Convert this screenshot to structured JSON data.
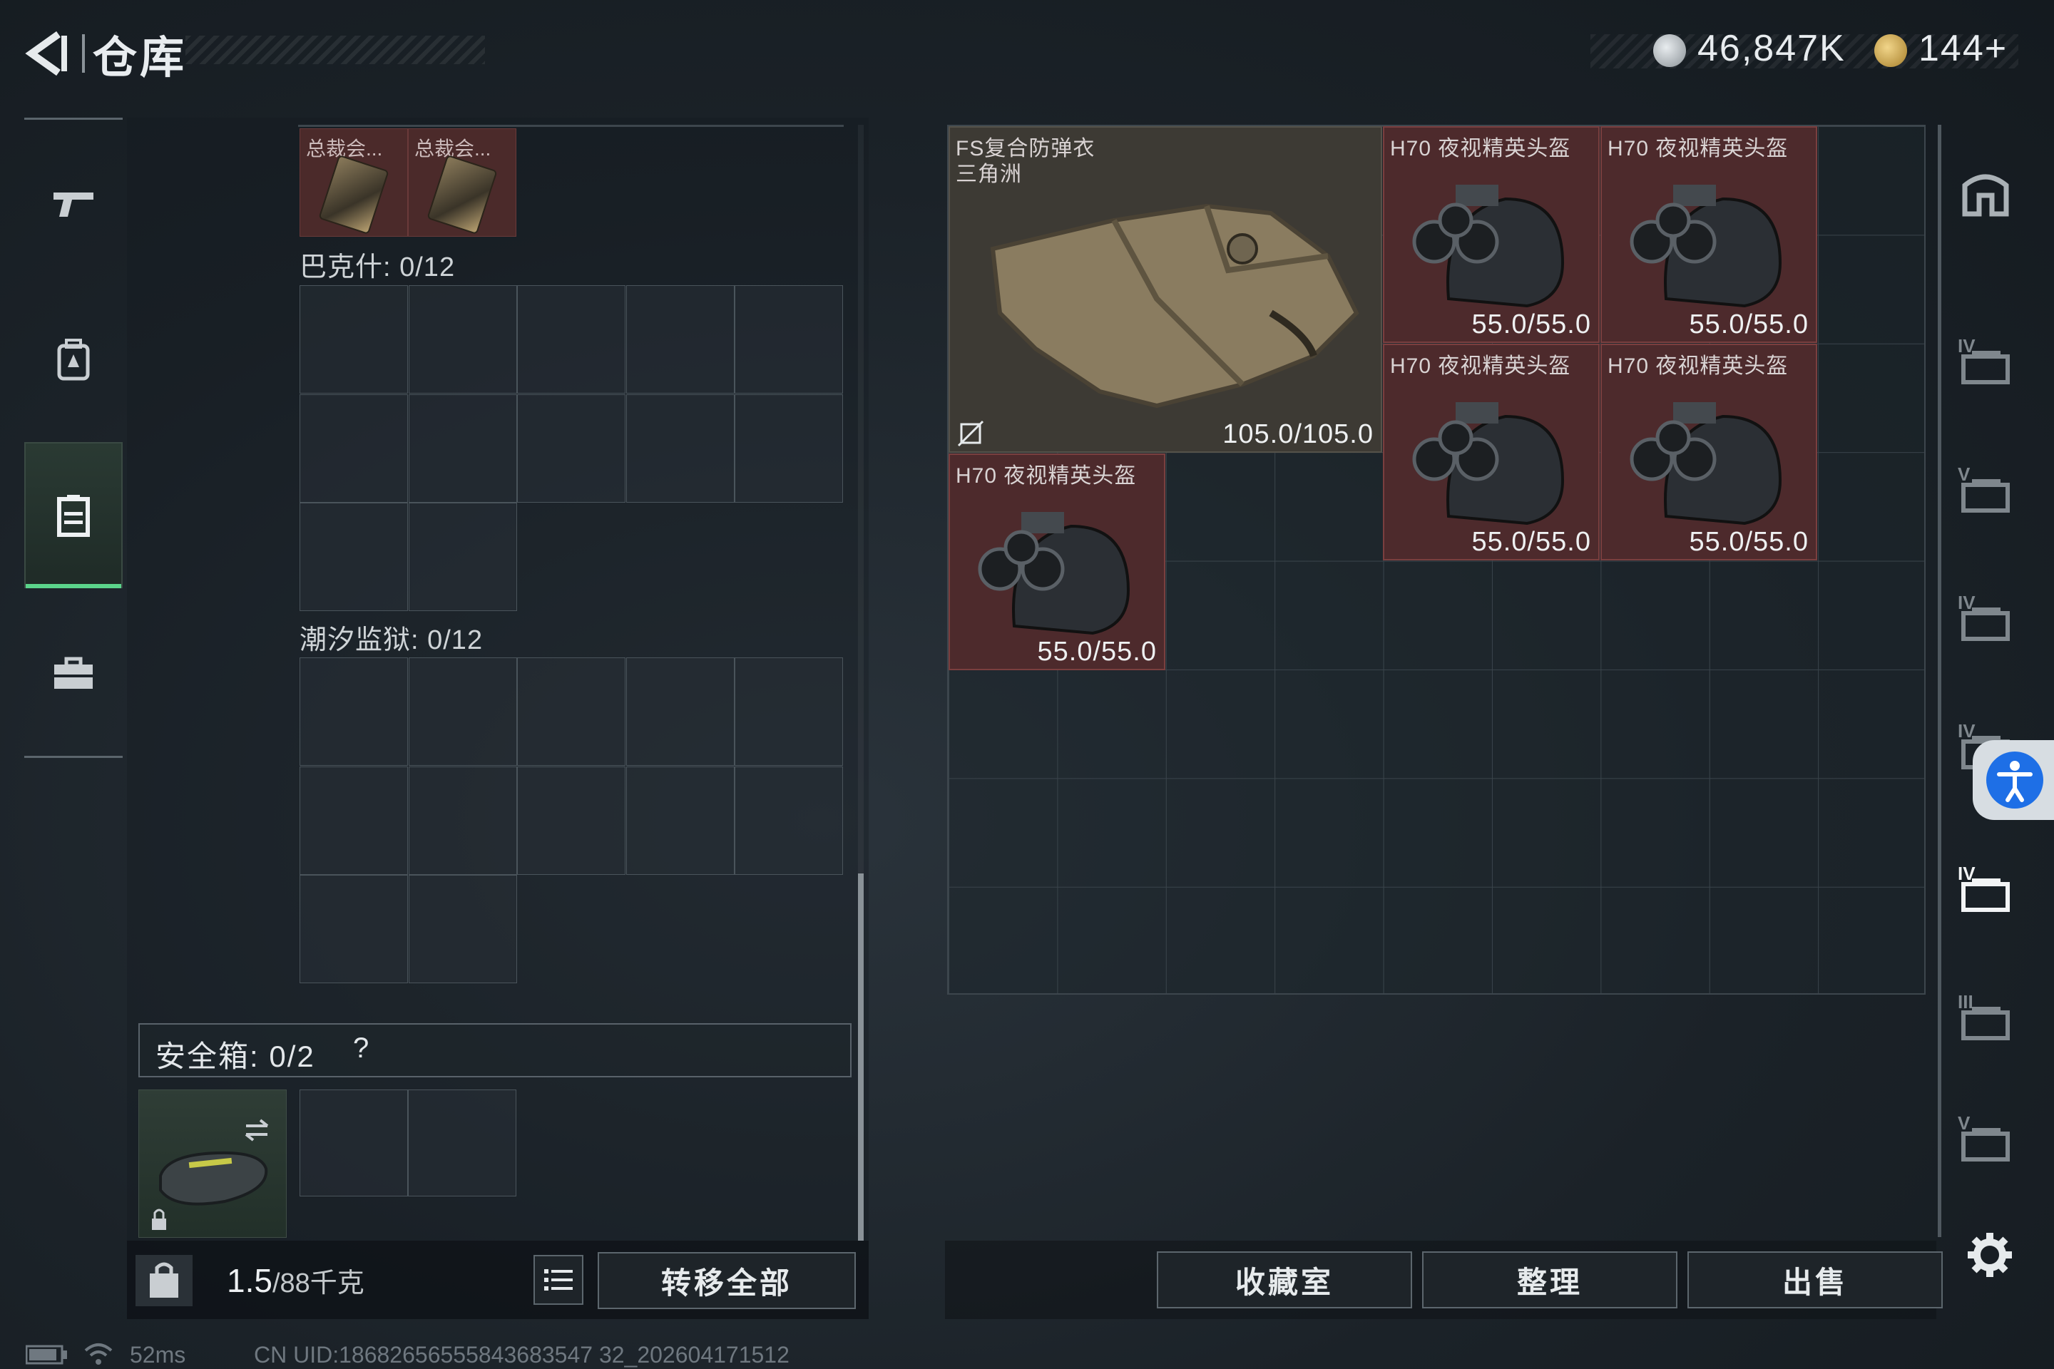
{
  "header": {
    "title": "仓库",
    "currency1": "46,847K",
    "currency2": "144+",
    "colors": {
      "coin1": "#b9bec2",
      "coin2": "#c9a24a"
    }
  },
  "nav": {
    "items": [
      {
        "name": "weapon-icon",
        "active": false
      },
      {
        "name": "backpack-icon",
        "active": false
      },
      {
        "name": "storage-icon",
        "active": true
      },
      {
        "name": "toolbox-icon",
        "active": false
      }
    ],
    "accent": "#5bd48b"
  },
  "left_panel": {
    "top_items": [
      {
        "label": "总裁会..."
      },
      {
        "label": "总裁会..."
      }
    ],
    "sections": [
      {
        "label": "巴克什: 0/12"
      },
      {
        "label": "潮汐监狱: 0/12"
      }
    ],
    "safe_box": {
      "label": "安全箱:  0/2",
      "help": "?"
    },
    "weight": {
      "value": "1.5",
      "unit": "/88千克"
    },
    "transfer_all": "转移全部"
  },
  "right_panel": {
    "items": [
      {
        "name": "FS复合防弹衣",
        "subname": "三角洲",
        "durability": "105.0/105.0"
      },
      {
        "name": "H70 夜视精英头盔",
        "durability": "55.0/55.0"
      },
      {
        "name": "H70 夜视精英头盔",
        "durability": "55.0/55.0"
      },
      {
        "name": "H70 夜视精英头盔",
        "durability": "55.0/55.0"
      },
      {
        "name": "H70 夜视精英头盔",
        "durability": "55.0/55.0"
      },
      {
        "name": "H70 夜视精英头盔",
        "durability": "55.0/55.0"
      }
    ],
    "buttons": {
      "collection": "收藏室",
      "organize": "整理",
      "sell": "出售"
    },
    "tabs": [
      "IV",
      "V",
      "IV",
      "IV",
      "IV",
      "III",
      "V"
    ]
  },
  "status": {
    "ping": "52ms",
    "uid": "CN UID:18682656555843683547 32_202604171512"
  }
}
